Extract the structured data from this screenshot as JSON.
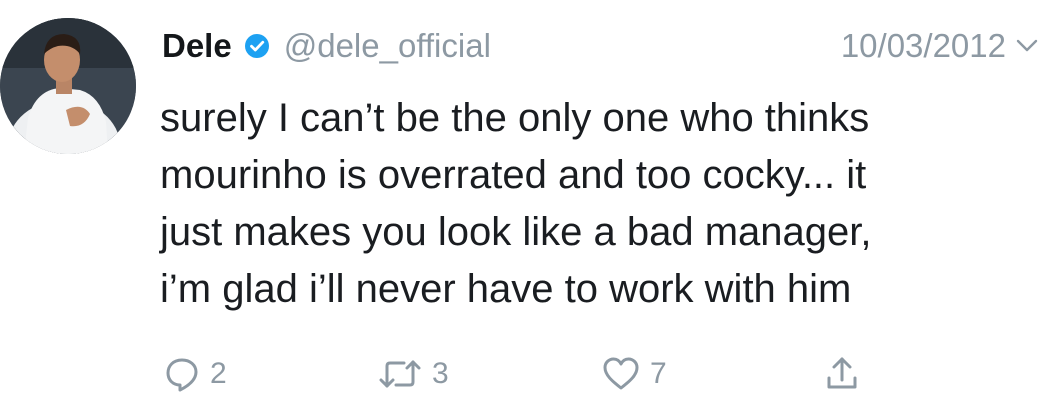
{
  "tweet": {
    "author_name": "Dele",
    "handle": "@dele_official",
    "date": "10/03/2012",
    "text_lines": [
      "surely I can’t be the only one who thinks",
      "mourinho is overrated and too cocky... it",
      "just makes you look like a bad manager,",
      "i’m glad i’ll never have to work with him"
    ],
    "replies": "2",
    "retweets": "3",
    "likes": "7"
  },
  "icons": {
    "verified": "verified-badge-icon",
    "chevron": "chevron-down-icon",
    "reply": "reply-icon",
    "retweet": "retweet-icon",
    "like": "heart-icon",
    "share": "share-icon"
  },
  "colors": {
    "verified_blue": "#1da1f2",
    "muted_gray": "#8d99a3",
    "text": "#14171a"
  }
}
